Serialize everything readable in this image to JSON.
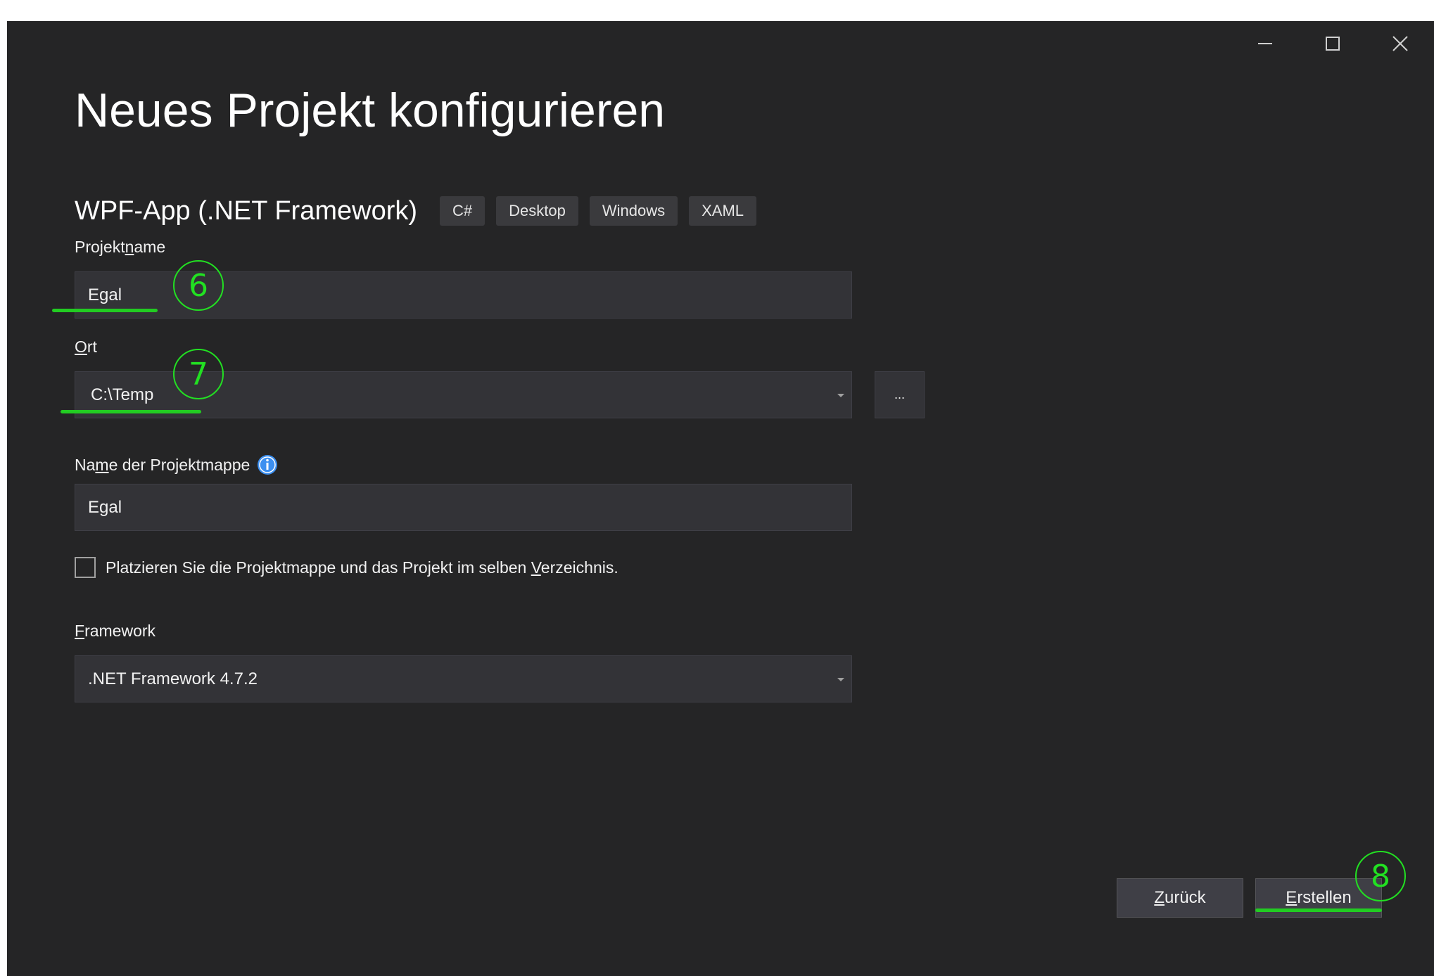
{
  "window": {
    "controls": {
      "minimize": "minimize-icon",
      "maximize": "maximize-icon",
      "close": "close-icon"
    }
  },
  "page_title": "Neues Projekt konfigurieren",
  "template": {
    "name": "WPF-App (.NET Framework)",
    "tags": [
      "C#",
      "Desktop",
      "Windows",
      "XAML"
    ]
  },
  "fields": {
    "project_name": {
      "label_pre": "Projekt",
      "label_key": "n",
      "label_post": "ame",
      "value": "Egal"
    },
    "location": {
      "label_key": "O",
      "label_post": "rt",
      "value": "C:\\Temp",
      "browse_label": "..."
    },
    "solution_name": {
      "label_pre": "Na",
      "label_key": "m",
      "label_post": "e der Projektmappe",
      "value": "Egal",
      "info_icon": "info-icon"
    },
    "same_directory": {
      "label_pre": "Platzieren Sie die Projektmappe und das Projekt im selben ",
      "label_key": "V",
      "label_post": "erzeichnis.",
      "checked": false
    },
    "framework": {
      "label_key": "F",
      "label_post": "ramework",
      "value": ".NET Framework 4.7.2"
    }
  },
  "footer": {
    "back_key": "Z",
    "back_rest": "urück",
    "create_key": "E",
    "create_rest": "rstellen"
  },
  "annotations": {
    "step_6": "6",
    "step_7": "7",
    "step_8": "8",
    "color": "#22e022"
  },
  "colors": {
    "background": "#252526",
    "input_background": "#333337",
    "tag_background": "#3a3a3d",
    "button_background": "#3f3f46",
    "info_blue": "#3c8ff0"
  }
}
